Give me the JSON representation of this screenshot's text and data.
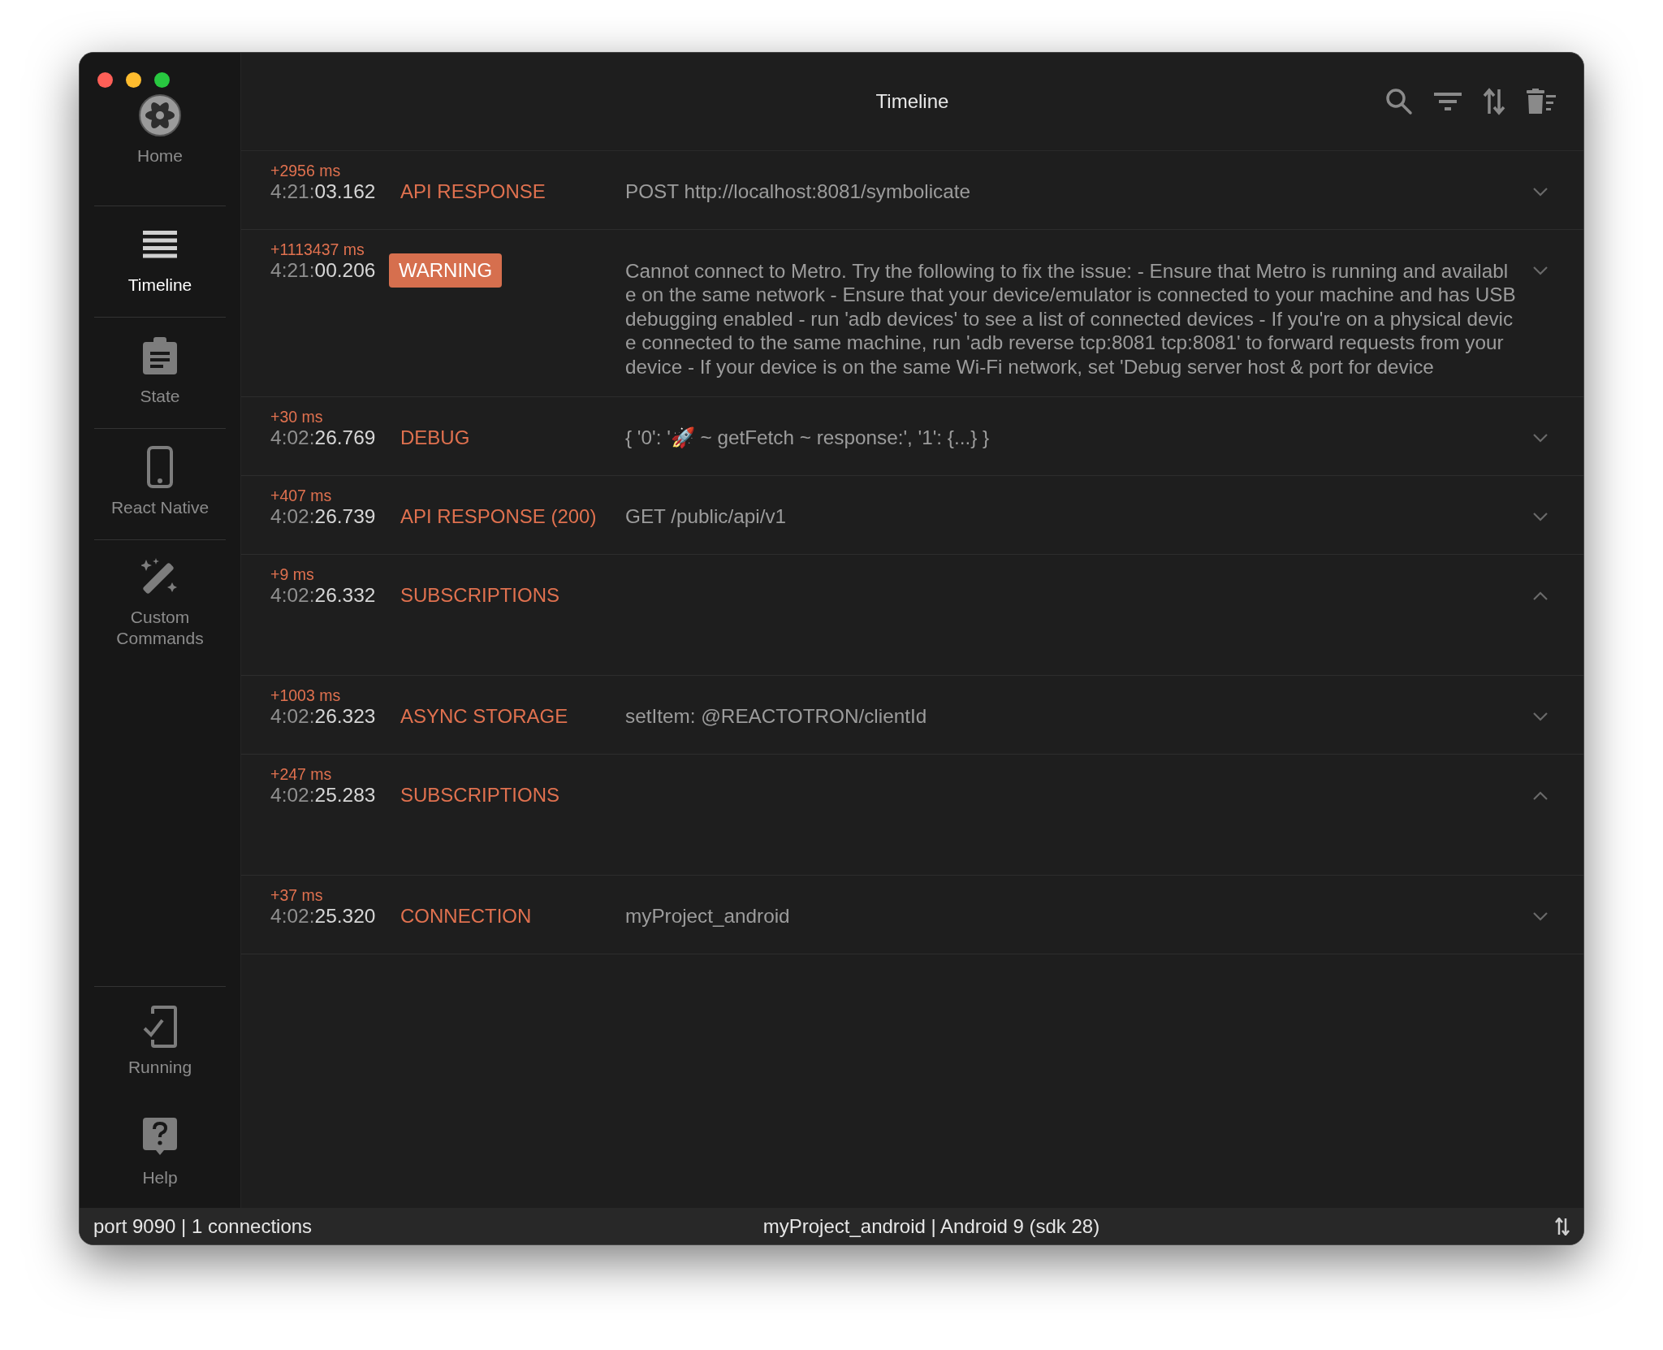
{
  "window": {
    "title": "Timeline"
  },
  "sidebar": {
    "items": [
      {
        "label": "Home",
        "selected": false
      },
      {
        "label": "Timeline",
        "selected": true
      },
      {
        "label": "State",
        "selected": false
      },
      {
        "label": "React Native",
        "selected": false
      },
      {
        "label": "Custom Commands",
        "selected": false
      }
    ],
    "bottom_items": [
      {
        "label": "Running",
        "selected": false
      },
      {
        "label": "Help",
        "selected": false
      }
    ]
  },
  "timeline": [
    {
      "delta": "+2956 ms",
      "time_prefix": "4:21:",
      "time_rest": "03.162",
      "type": "API RESPONSE",
      "kind": "plain",
      "message": "POST http://localhost:8081/symbolicate",
      "expanded": false
    },
    {
      "delta": "+1113437 ms",
      "time_prefix": "4:21:",
      "time_rest": "00.206",
      "type": "WARNING",
      "kind": "badge",
      "message": "Cannot connect to Metro. Try the following to fix the issue: - Ensure that Metro is running and available on the same network - Ensure that your device/emulator is connected to your machine and has USB debugging enabled - run 'adb devices' to see a list of connected devices - If you're on a physical device connected to the same machine, run 'adb reverse tcp:8081 tcp:8081' to forward requests from your device - If your device is on the same Wi-Fi network, set 'Debug server host & port for device",
      "expanded": false
    },
    {
      "delta": "+30 ms",
      "time_prefix": "4:02:",
      "time_rest": "26.769",
      "type": "DEBUG",
      "kind": "plain",
      "message": "{ '0': '🚀 ~ getFetch ~ response:', '1': {...} }",
      "expanded": false
    },
    {
      "delta": "+407 ms",
      "time_prefix": "4:02:",
      "time_rest": "26.739",
      "type": "API RESPONSE (200)",
      "kind": "plain",
      "message": "GET /public/api/v1",
      "expanded": false
    },
    {
      "delta": "+9 ms",
      "time_prefix": "4:02:",
      "time_rest": "26.332",
      "type": "SUBSCRIPTIONS",
      "kind": "plain",
      "expanded": true
    },
    {
      "delta": "+1003 ms",
      "time_prefix": "4:02:",
      "time_rest": "26.323",
      "type": "ASYNC STORAGE",
      "kind": "plain",
      "message": "setItem: @REACTOTRON/clientId",
      "expanded": false
    },
    {
      "delta": "+247 ms",
      "time_prefix": "4:02:",
      "time_rest": "25.283",
      "type": "SUBSCRIPTIONS",
      "kind": "plain",
      "expanded": true
    },
    {
      "delta": "+37 ms",
      "time_prefix": "4:02:",
      "time_rest": "25.320",
      "type": "CONNECTION",
      "kind": "plain",
      "message": "myProject_android",
      "expanded": false
    }
  ],
  "status_bar": {
    "left": "port 9090 | 1 connections",
    "center": "myProject_android | Android 9 (sdk 28)"
  }
}
